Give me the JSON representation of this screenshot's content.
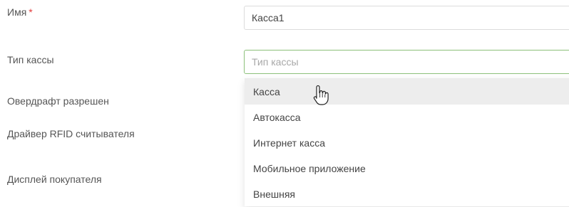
{
  "form": {
    "name": {
      "label": "Имя",
      "required_mark": "*",
      "value": "Касса1"
    },
    "cash_type": {
      "label": "Тип кассы",
      "placeholder": "Тип кассы",
      "value": ""
    },
    "overdraft": {
      "label": "Овердрафт разрешен"
    },
    "rfid_driver": {
      "label": "Драйвер RFID считывателя"
    },
    "customer_display": {
      "label": "Дисплей покупателя"
    }
  },
  "dropdown": {
    "hovered_index": 0,
    "options": [
      {
        "label": "Касса"
      },
      {
        "label": "Автокасса"
      },
      {
        "label": "Интернет касса"
      },
      {
        "label": "Мобильное приложение"
      },
      {
        "label": "Внешняя"
      }
    ]
  },
  "colors": {
    "required": "#e23b3b",
    "focus_border": "#8cc07a",
    "hover_bg": "#ededed"
  },
  "icons": {
    "cursor": "hand-pointer-icon"
  }
}
